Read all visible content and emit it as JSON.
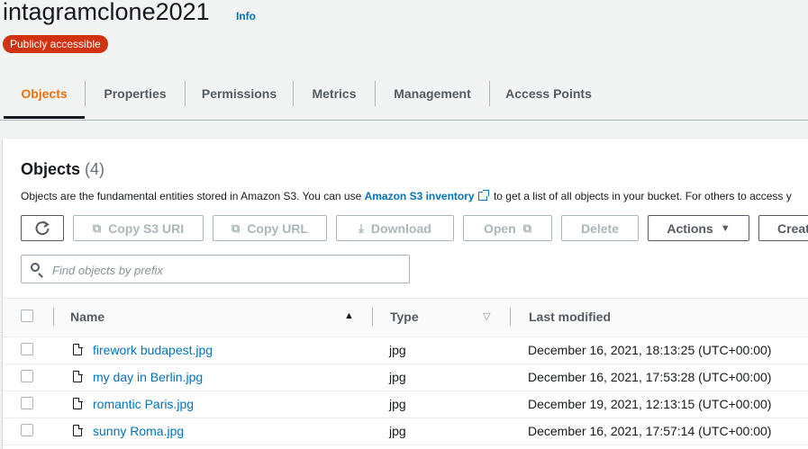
{
  "bucket": {
    "name": "intagramclone2021",
    "info_link": "Info",
    "access_badge": "Publicly accessible"
  },
  "tabs": [
    {
      "label": "Objects",
      "active": true
    },
    {
      "label": "Properties",
      "active": false
    },
    {
      "label": "Permissions",
      "active": false
    },
    {
      "label": "Metrics",
      "active": false
    },
    {
      "label": "Management",
      "active": false
    },
    {
      "label": "Access Points",
      "active": false
    }
  ],
  "objects_panel": {
    "title": "Objects",
    "count": "(4)",
    "description_prefix": "Objects are the fundamental entities stored in Amazon S3. You can use ",
    "inventory_link": "Amazon S3 inventory",
    "description_suffix": " to get a list of all objects in your bucket. For others to access y"
  },
  "toolbar": {
    "refresh_icon": "refresh-icon",
    "copy_s3_uri": "Copy S3 URI",
    "copy_url": "Copy URL",
    "download": "Download",
    "open": "Open",
    "delete": "Delete",
    "actions": "Actions",
    "create": "Creat"
  },
  "search": {
    "placeholder": "Find objects by prefix",
    "value": ""
  },
  "table": {
    "columns": {
      "name": "Name",
      "type": "Type",
      "last_modified": "Last modified"
    },
    "rows": [
      {
        "name": "firework budapest.jpg",
        "type": "jpg",
        "last_modified": "December 16, 2021, 18:13:25 (UTC+00:00)"
      },
      {
        "name": "my day in Berlin.jpg",
        "type": "jpg",
        "last_modified": "December 16, 2021, 17:53:28 (UTC+00:00)"
      },
      {
        "name": "romantic Paris.jpg",
        "type": "jpg",
        "last_modified": "December 19, 2021, 12:13:15 (UTC+00:00)"
      },
      {
        "name": "sunny Roma.jpg",
        "type": "jpg",
        "last_modified": "December 16, 2021, 17:57:14 (UTC+00:00)"
      }
    ]
  },
  "colors": {
    "accent_orange": "#ec7211",
    "link_blue": "#0073bb",
    "badge_red": "#d13212"
  }
}
